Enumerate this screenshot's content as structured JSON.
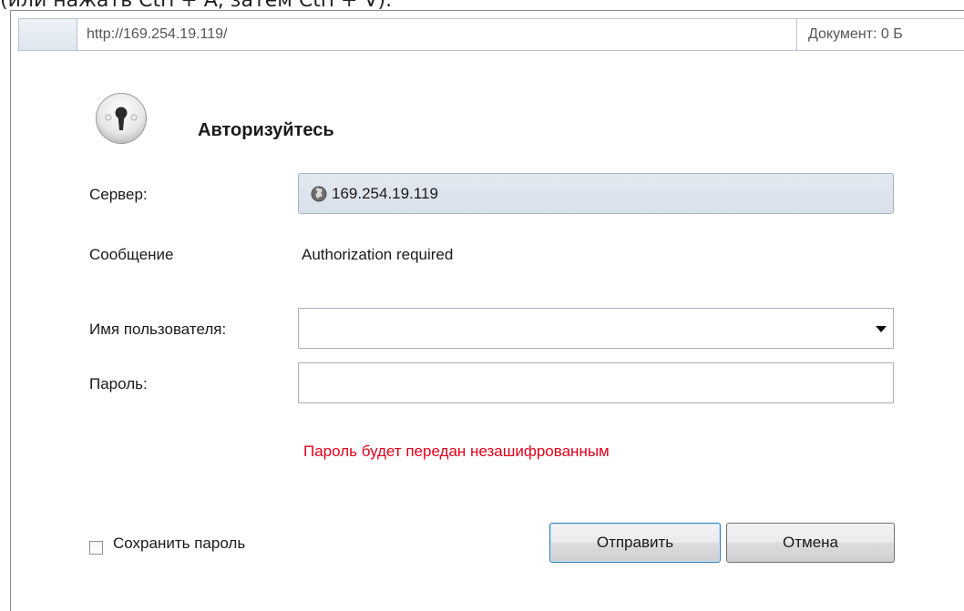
{
  "top_strip": {
    "text": "(или нажать Ctrl + A, затем Ctrl + V)."
  },
  "address_bar": {
    "url": "http://169.254.19.119/",
    "document_size": "Документ:  0 Б"
  },
  "dialog": {
    "title": "Авторизуйтесь",
    "server_label": "Сервер:",
    "server_value": "169.254.19.119",
    "message_label": "Сообщение",
    "message_value": "Authorization required",
    "username_label": "Имя пользователя:",
    "username_value": "",
    "password_label": "Пароль:",
    "password_value": "",
    "warning": "Пароль будет передан незашифрованным",
    "warning_color": "#e3001b",
    "save_password_label": "Сохранить пароль",
    "save_password_checked": false,
    "submit_label": "Отправить",
    "cancel_label": "Отмена"
  },
  "icons": {
    "lock": "keyhole-lock-icon",
    "globe": "globe-icon",
    "dropdown": "chevron-down-icon"
  }
}
